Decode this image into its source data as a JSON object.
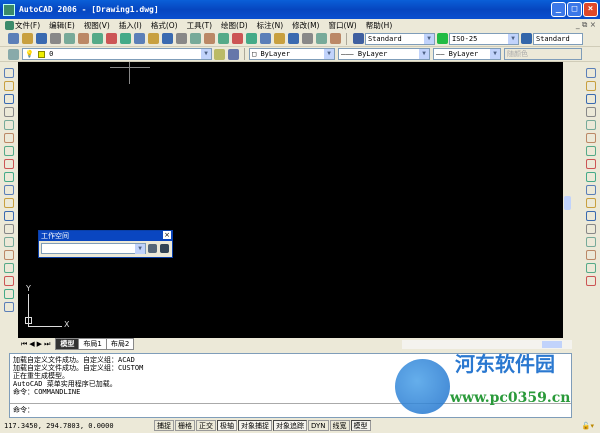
{
  "window": {
    "title": "AutoCAD 2006 - [Drawing1.dwg]",
    "minimize": "_",
    "maximize": "□",
    "close": "×",
    "doc_controls": "_ ⧉ ×"
  },
  "menu": [
    "文件(F)",
    "编辑(E)",
    "视图(V)",
    "插入(I)",
    "格式(O)",
    "工具(T)",
    "绘图(D)",
    "标注(N)",
    "修改(M)",
    "窗口(W)",
    "帮助(H)"
  ],
  "toolbar1": {
    "icons": [
      "new-icon",
      "open-icon",
      "save-icon",
      "print-icon",
      "preview-icon",
      "publish-icon",
      "cut-icon",
      "copy-icon",
      "paste-icon",
      "match-prop-icon",
      "brush-icon",
      "undo-icon",
      "redo-icon",
      "pan-icon",
      "zoom-realtime-icon",
      "zoom-window-icon",
      "zoom-previous-icon",
      "properties-icon",
      "design-center-icon",
      "tool-palette-icon",
      "sheet-set-icon",
      "markup-icon",
      "calculator-icon",
      "help-icon"
    ],
    "text_style": "Standard",
    "dim_style": "ISO-25",
    "table_style": "Standard"
  },
  "toolbar2": {
    "layer": "0",
    "color": "ByLayer",
    "linetype": "ByLayer",
    "lineweight": "ByLayer",
    "plot_style": "随颜色"
  },
  "left_tools": [
    "line-icon",
    "construction-line-icon",
    "polyline-icon",
    "polygon-icon",
    "rectangle-icon",
    "arc-icon",
    "circle-icon",
    "revcloud-icon",
    "spline-icon",
    "ellipse-icon",
    "ellipse-arc-icon",
    "insert-block-icon",
    "make-block-icon",
    "point-icon",
    "hatch-icon",
    "gradient-icon",
    "region-icon",
    "table-icon",
    "mtext-icon"
  ],
  "right_tools": [
    "erase-icon",
    "copy-obj-icon",
    "mirror-icon",
    "offset-icon",
    "array-icon",
    "move-icon",
    "rotate-icon",
    "scale-icon",
    "stretch-icon",
    "trim-icon",
    "extend-icon",
    "break-point-icon",
    "break-icon",
    "join-icon",
    "chamfer-icon",
    "fillet-icon",
    "explode-icon"
  ],
  "workspace": {
    "title": "工作空间",
    "close": "×"
  },
  "ucs": {
    "x": "X",
    "y": "Y"
  },
  "tabs": [
    "模型",
    "布局1",
    "布局2"
  ],
  "command": {
    "lines": [
      "加载自定义文件成功。自定义组：ACAD",
      "加载自定义文件成功。自定义组：CUSTOM",
      "正在重生成模型。",
      "AutoCAD 菜单实用程序已加载。",
      "命令：COMMANDLINE"
    ],
    "prompt": "命令："
  },
  "status": {
    "coords": "117.3450, 294.7803, 0.0000",
    "toggles": [
      {
        "label": "捕捉",
        "on": false
      },
      {
        "label": "栅格",
        "on": false
      },
      {
        "label": "正交",
        "on": false
      },
      {
        "label": "极轴",
        "on": true
      },
      {
        "label": "对象捕捉",
        "on": true
      },
      {
        "label": "对象追踪",
        "on": true
      },
      {
        "label": "DYN",
        "on": false
      },
      {
        "label": "线宽",
        "on": false
      },
      {
        "label": "模型",
        "on": true
      }
    ]
  },
  "watermark": {
    "name": "河东软件园",
    "url": "www.pc0359.cn"
  }
}
